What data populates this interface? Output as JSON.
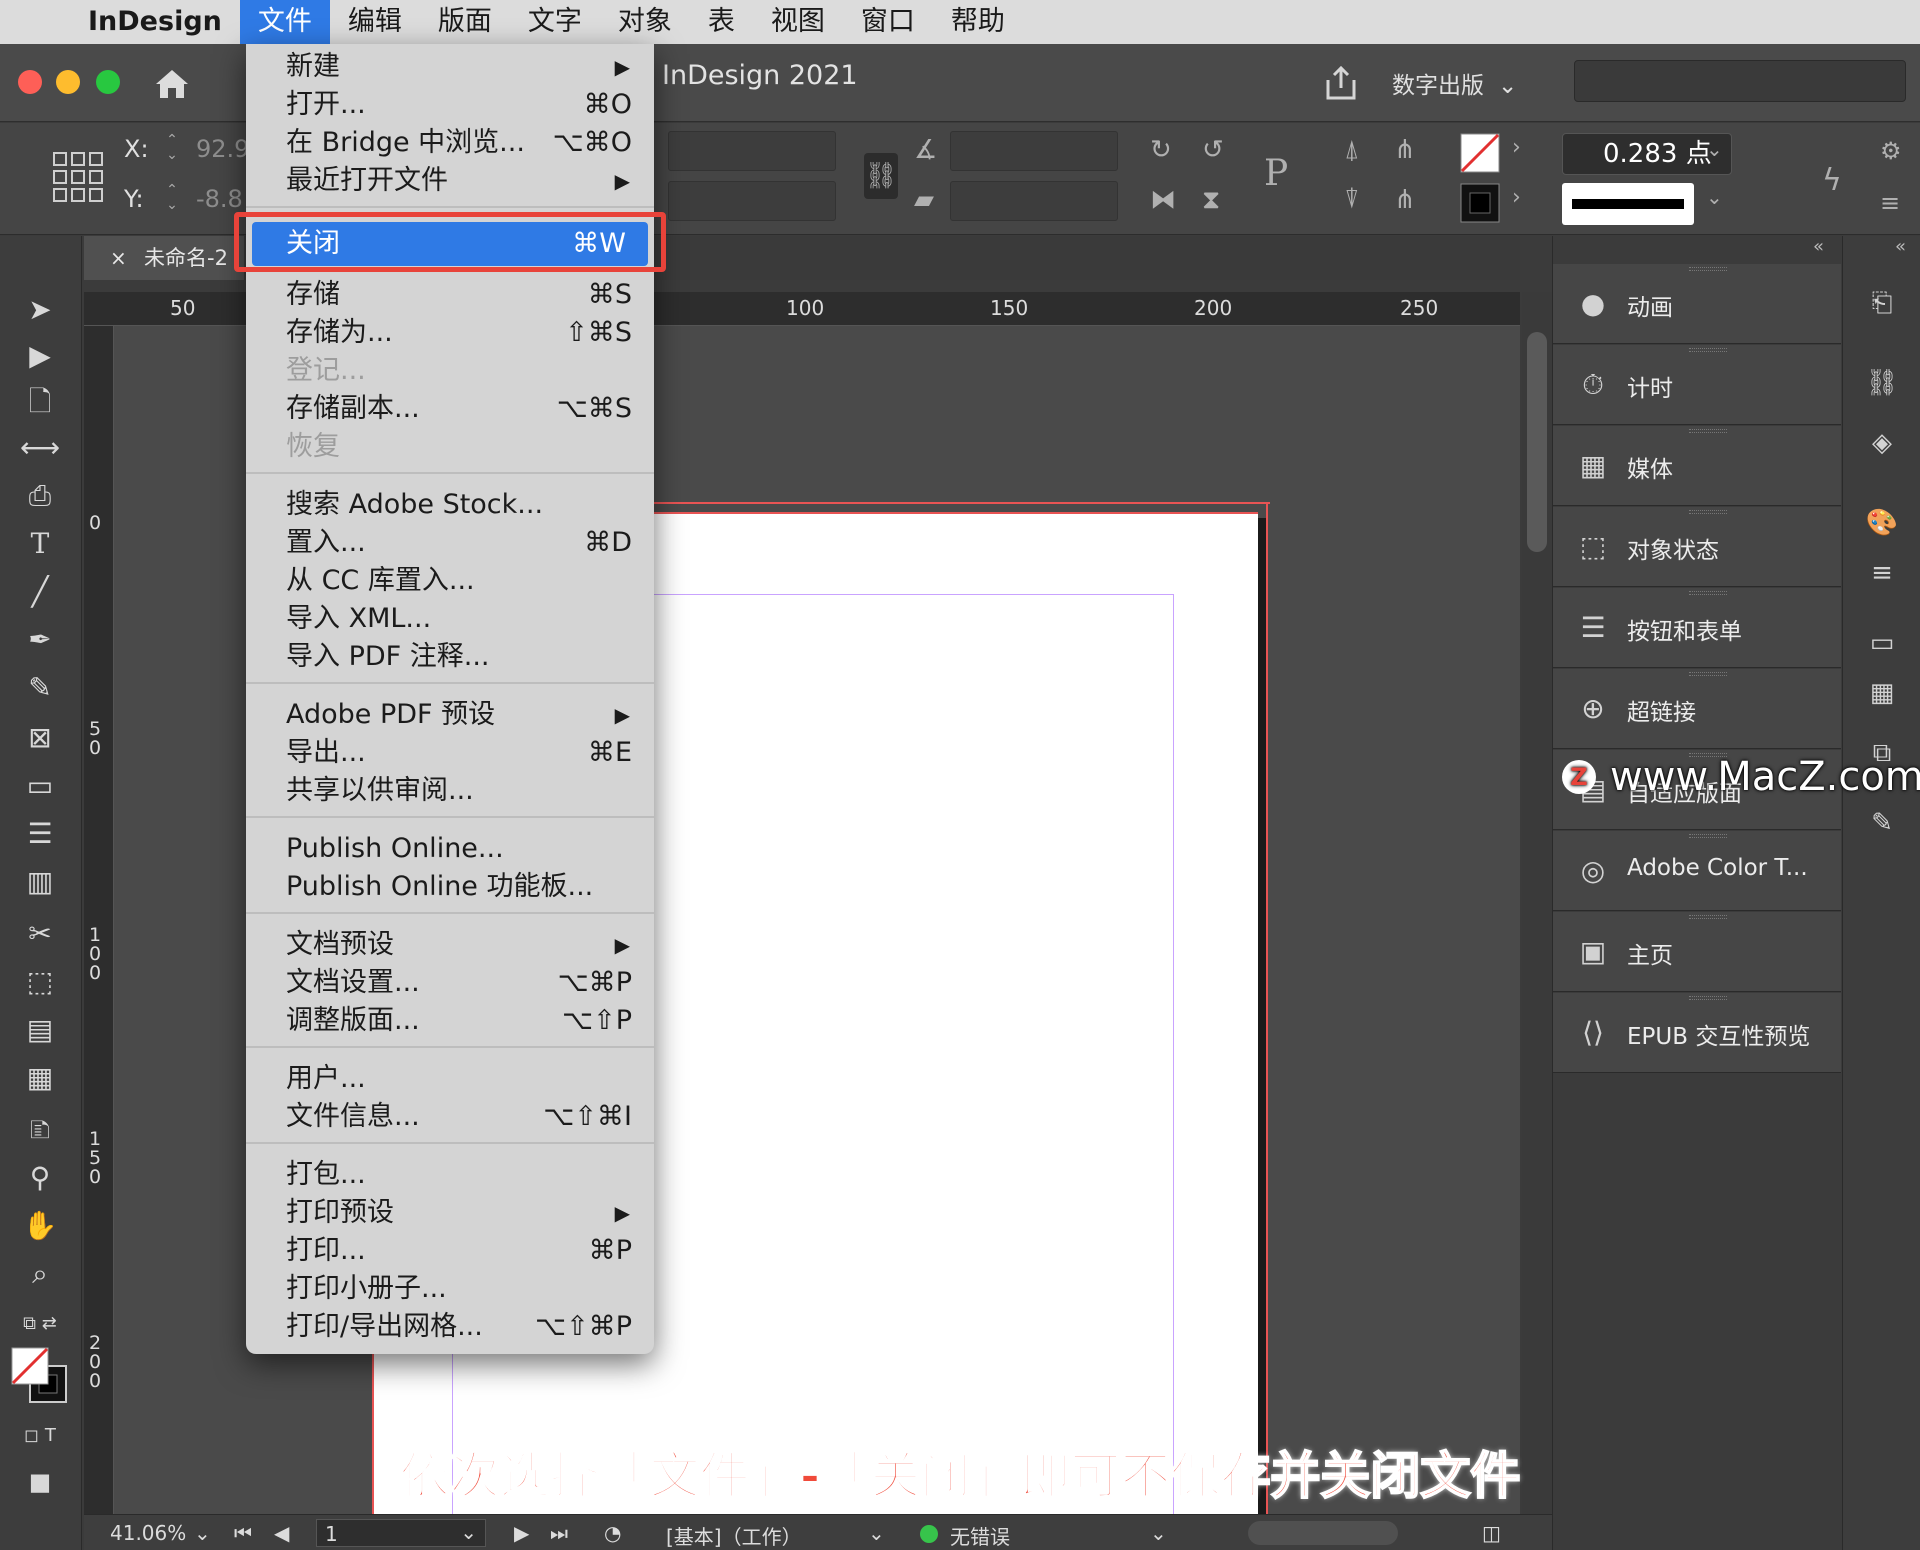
{
  "menubar": {
    "app_name": "InDesign",
    "items": [
      "文件",
      "编辑",
      "版面",
      "文字",
      "对象",
      "表",
      "视图",
      "窗口",
      "帮助"
    ],
    "active_index": 0
  },
  "titlebar": {
    "title": "InDesign 2021",
    "workspace": "数字出版"
  },
  "controlbar": {
    "x_label": "X:",
    "x_value": "92.9",
    "y_label": "Y:",
    "y_value": "-8.8",
    "stroke_weight": "0.283 点"
  },
  "document": {
    "tab_name": "未命名-2",
    "close_glyph": "×"
  },
  "ruler": {
    "h_ticks": [
      "50",
      "100",
      "150",
      "200",
      "250"
    ],
    "v_ticks": [
      "0",
      "50",
      "100",
      "150",
      "200"
    ]
  },
  "file_menu": {
    "groups": [
      [
        {
          "label": "新建",
          "submenu": true
        },
        {
          "label": "打开...",
          "shortcut": "⌘O"
        },
        {
          "label": "在 Bridge 中浏览...",
          "shortcut": "⌥⌘O"
        },
        {
          "label": "最近打开文件",
          "submenu": true
        }
      ],
      [
        {
          "label": "关闭",
          "shortcut": "⌘W",
          "highlighted": true
        },
        {
          "label": "存储",
          "shortcut": "⌘S"
        },
        {
          "label": "存储为...",
          "shortcut": "⇧⌘S"
        },
        {
          "label": "登记...",
          "disabled": true
        },
        {
          "label": "存储副本...",
          "shortcut": "⌥⌘S"
        },
        {
          "label": "恢复",
          "disabled": true
        }
      ],
      [
        {
          "label": "搜索 Adobe Stock..."
        },
        {
          "label": "置入...",
          "shortcut": "⌘D"
        },
        {
          "label": "从 CC 库置入..."
        },
        {
          "label": "导入 XML..."
        },
        {
          "label": "导入 PDF 注释..."
        }
      ],
      [
        {
          "label": "Adobe PDF 预设",
          "submenu": true
        },
        {
          "label": "导出...",
          "shortcut": "⌘E"
        },
        {
          "label": "共享以供审阅..."
        }
      ],
      [
        {
          "label": "Publish Online..."
        },
        {
          "label": "Publish Online 功能板..."
        }
      ],
      [
        {
          "label": "文档预设",
          "submenu": true
        },
        {
          "label": "文档设置...",
          "shortcut": "⌥⌘P"
        },
        {
          "label": "调整版面...",
          "shortcut": "⌥⇧P"
        }
      ],
      [
        {
          "label": "用户..."
        },
        {
          "label": "文件信息...",
          "shortcut": "⌥⇧⌘I"
        }
      ],
      [
        {
          "label": "打包..."
        },
        {
          "label": "打印预设",
          "submenu": true
        },
        {
          "label": "打印...",
          "shortcut": "⌘P"
        },
        {
          "label": "打印小册子..."
        },
        {
          "label": "打印/导出网格...",
          "shortcut": "⌥⇧⌘P"
        }
      ]
    ]
  },
  "panels": [
    {
      "label": "动画",
      "icon": "animation-icon",
      "glyph": "●"
    },
    {
      "label": "计时",
      "icon": "timer-icon",
      "glyph": "⏱"
    },
    {
      "label": "媒体",
      "icon": "media-icon",
      "glyph": "▦"
    },
    {
      "label": "对象状态",
      "icon": "object-states-icon",
      "glyph": "⬚"
    },
    {
      "label": "按钮和表单",
      "icon": "buttons-forms-icon",
      "glyph": "☰"
    },
    {
      "label": "超链接",
      "icon": "hyperlinks-icon",
      "glyph": "⊕"
    },
    {
      "label": "自适应版面",
      "icon": "liquid-layout-icon",
      "glyph": "▤"
    },
    {
      "label": "Adobe Color T...",
      "icon": "adobe-color-icon",
      "glyph": "◎"
    },
    {
      "label": "主页",
      "icon": "pages-icon",
      "glyph": "▣"
    },
    {
      "label": "EPUB 交互性预览",
      "icon": "epub-preview-icon",
      "glyph": "⟨⟩"
    }
  ],
  "statusbar": {
    "zoom": "41.06%",
    "page": "1",
    "profile": "[基本]（工作）",
    "preflight": "无错误"
  },
  "overlay": {
    "watermark": "www.MacZ.com",
    "watermark_badge": "Z",
    "caption": "依次选择「文件」-「关闭」即可不保存并关闭文件"
  },
  "colors": {
    "accent": "#2f7ae5",
    "highlight_outline": "#e8433a",
    "caption": "#f04a3a",
    "preflight_ok": "#37c44b"
  }
}
